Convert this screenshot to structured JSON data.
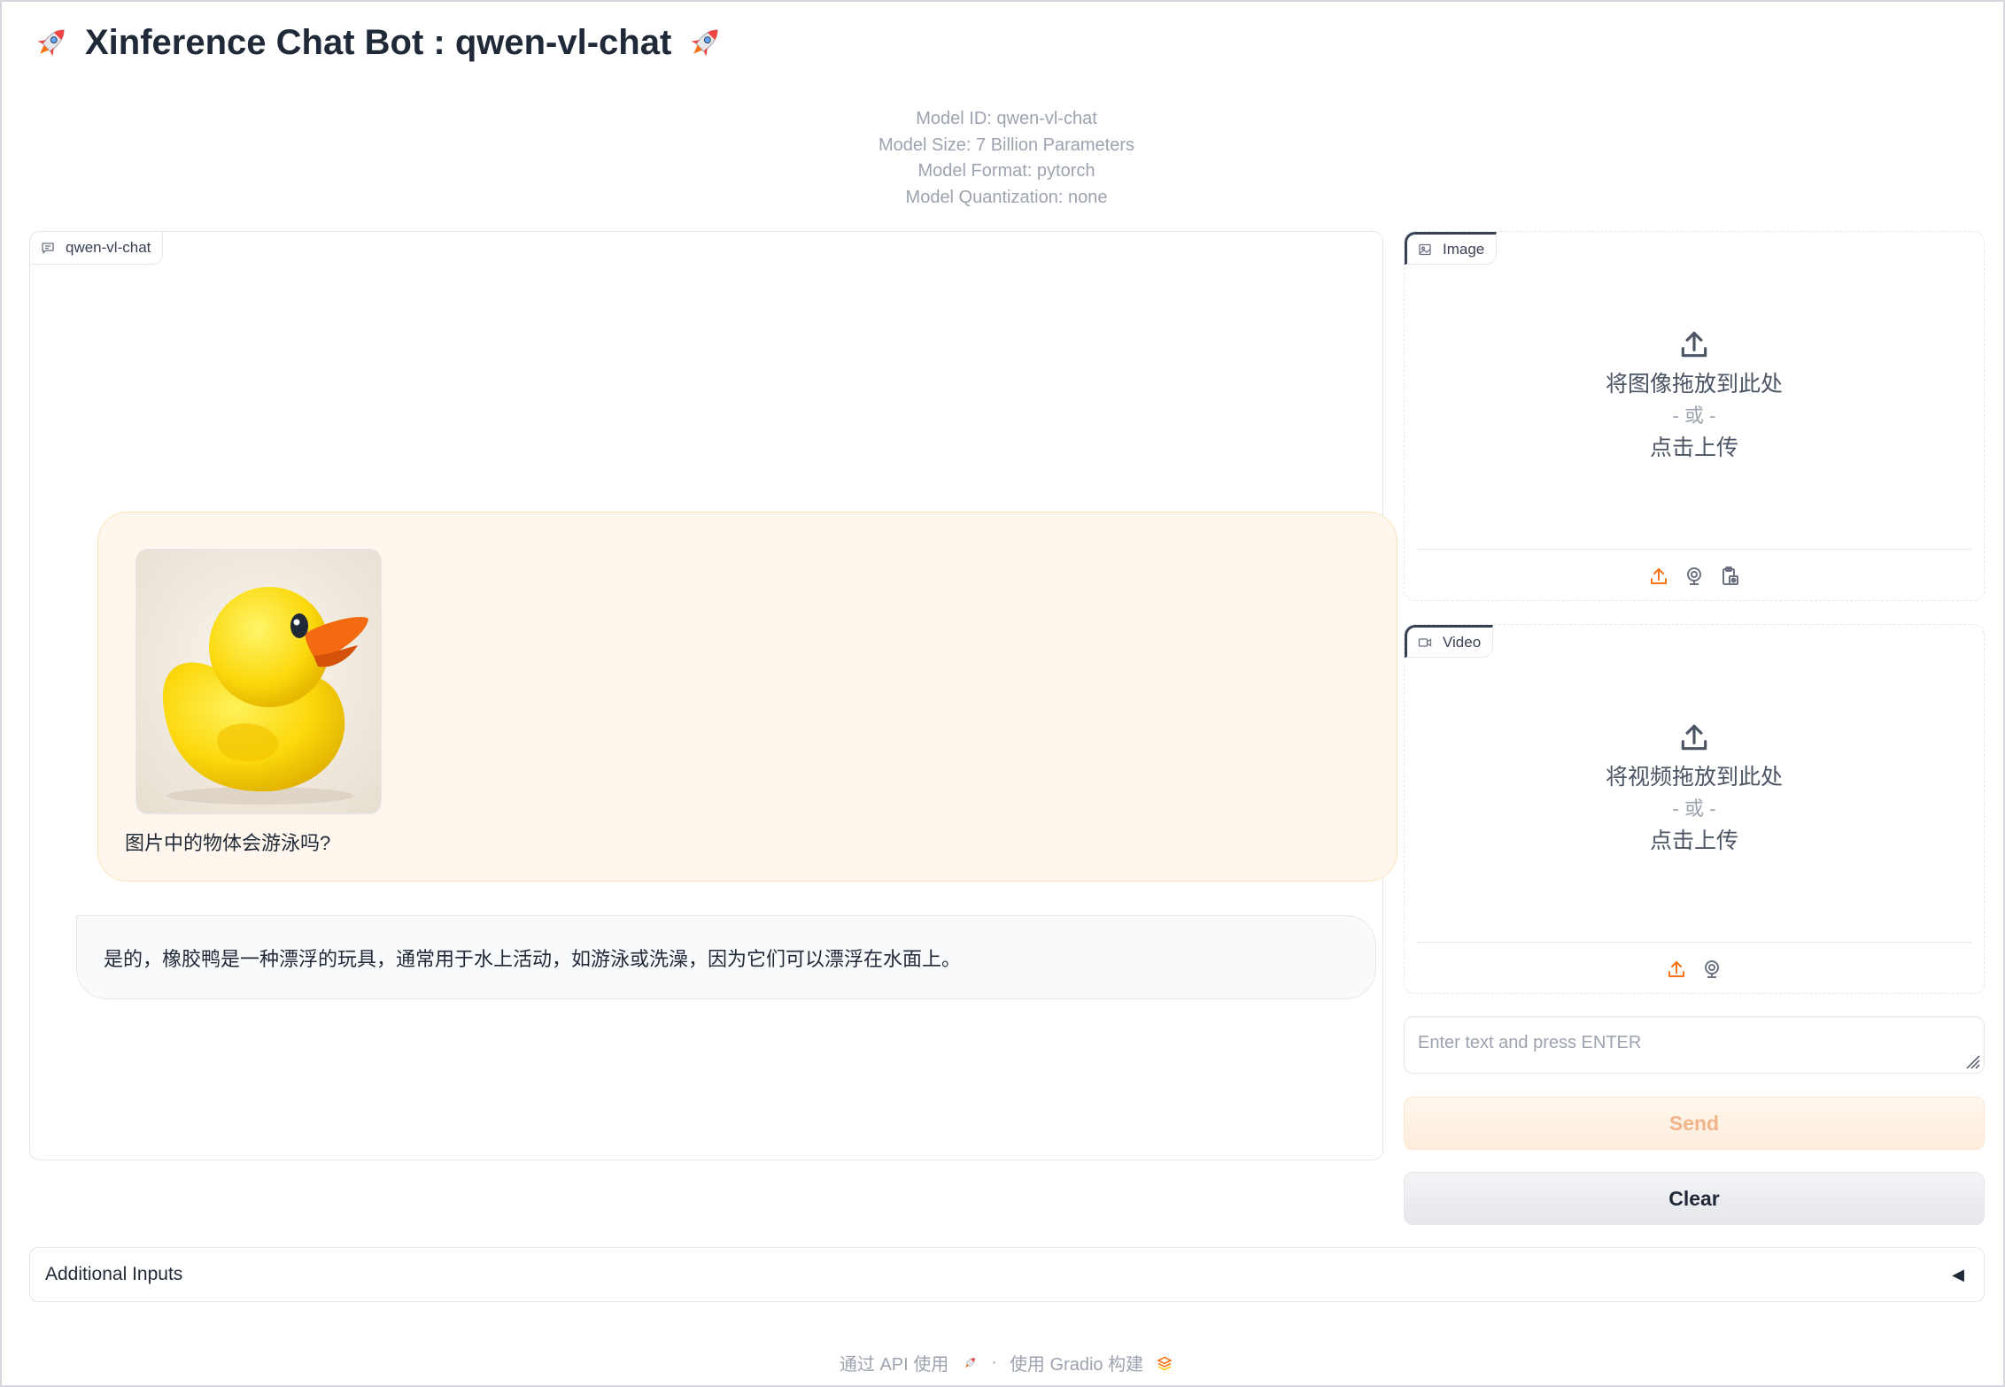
{
  "header": {
    "title": "Xinference Chat Bot : qwen-vl-chat",
    "left_icon": "rocket-icon",
    "right_icon": "rocket-icon"
  },
  "model_info": {
    "id": "Model ID: qwen-vl-chat",
    "size": "Model Size: 7 Billion Parameters",
    "format": "Model Format: pytorch",
    "quantization": "Model Quantization: none"
  },
  "chatbot": {
    "label": "qwen-vl-chat",
    "user_message": {
      "image": "rubber-duck-image",
      "text": "图片中的物体会游泳吗?"
    },
    "bot_message": {
      "text": "是的，橡胶鸭是一种漂浮的玩具，通常用于水上活动，如游泳或洗澡，因为它们可以漂浮在水面上。"
    }
  },
  "image_upload": {
    "label": "Image",
    "drop_text": "将图像拖放到此处",
    "or_text": "- 或 -",
    "click_text": "点击上传",
    "sources": [
      "upload-icon",
      "webcam-icon",
      "clipboard-icon"
    ]
  },
  "video_upload": {
    "label": "Video",
    "drop_text": "将视频拖放到此处",
    "or_text": "- 或 -",
    "click_text": "点击上传",
    "sources": [
      "upload-icon",
      "webcam-icon"
    ]
  },
  "input": {
    "placeholder": "Enter text and press ENTER",
    "value": ""
  },
  "buttons": {
    "send": "Send",
    "clear": "Clear"
  },
  "accordion": {
    "label": "Additional Inputs",
    "caret": "◀"
  },
  "footer": {
    "api": "通过 API 使用",
    "separator": "·",
    "built_with": "使用 Gradio 构建"
  },
  "colors": {
    "accent": "#f97316",
    "user_bubble": "#fff7ed",
    "bot_bubble": "#f9fafb",
    "muted_text": "#9ca3af"
  }
}
